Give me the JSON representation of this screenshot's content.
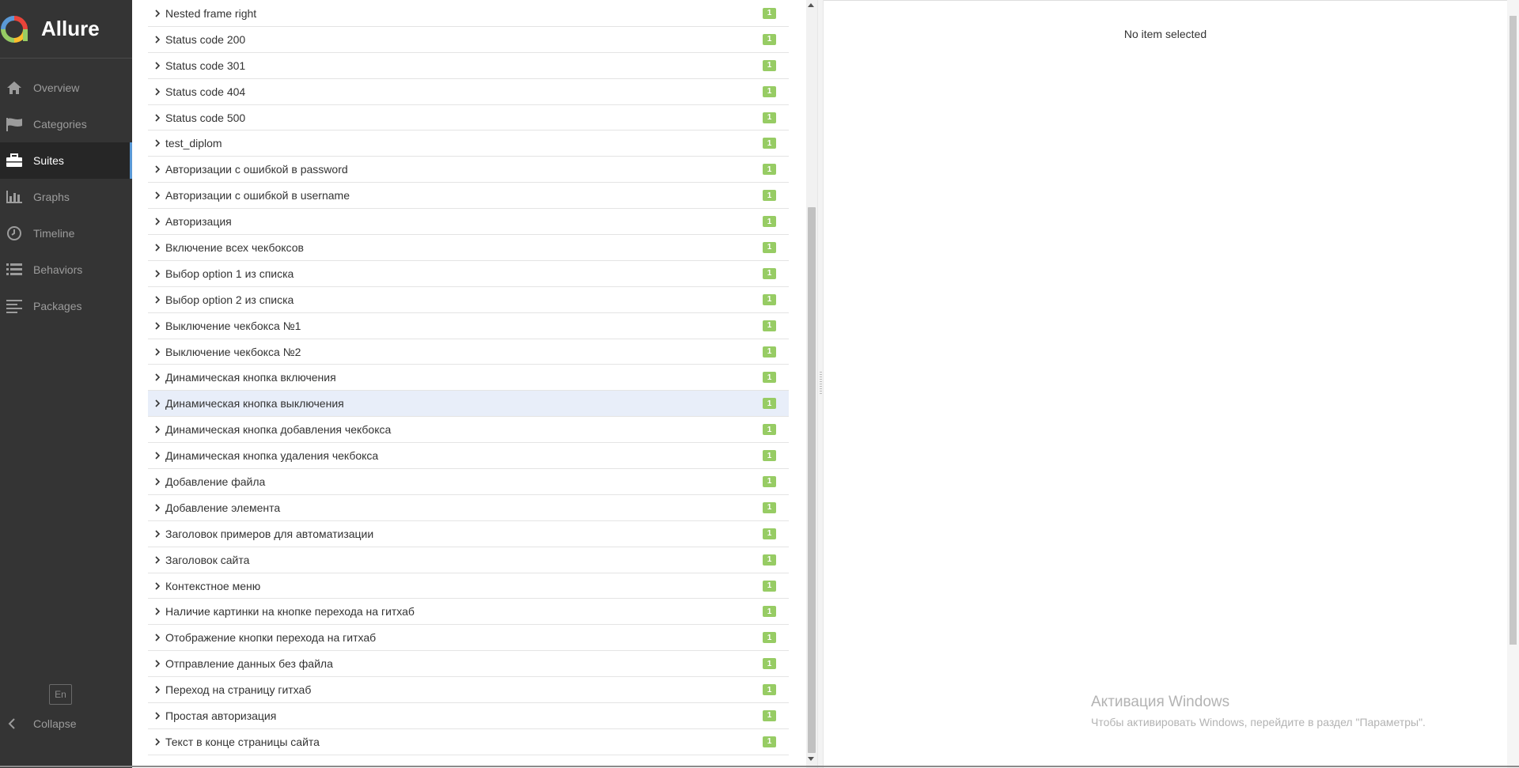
{
  "brand": {
    "name": "Allure"
  },
  "nav": {
    "items": [
      {
        "label": "Overview",
        "icon": "home-icon",
        "active": false
      },
      {
        "label": "Categories",
        "icon": "flag-icon",
        "active": false
      },
      {
        "label": "Suites",
        "icon": "briefcase-icon",
        "active": true
      },
      {
        "label": "Graphs",
        "icon": "bar-chart-icon",
        "active": false
      },
      {
        "label": "Timeline",
        "icon": "clock-icon",
        "active": false
      },
      {
        "label": "Behaviors",
        "icon": "list-icon",
        "active": false
      },
      {
        "label": "Packages",
        "icon": "align-left-icon",
        "active": false
      }
    ],
    "language": "En",
    "collapse_label": "Collapse"
  },
  "tree": {
    "rows": [
      {
        "label": "Nested frame right",
        "count": "1"
      },
      {
        "label": "Status code 200",
        "count": "1"
      },
      {
        "label": "Status code 301",
        "count": "1"
      },
      {
        "label": "Status code 404",
        "count": "1"
      },
      {
        "label": "Status code 500",
        "count": "1"
      },
      {
        "label": "test_diplom",
        "count": "1"
      },
      {
        "label": "Авторизации с ошибкой в password",
        "count": "1"
      },
      {
        "label": "Авторизации с ошибкой в username",
        "count": "1"
      },
      {
        "label": "Авторизация",
        "count": "1"
      },
      {
        "label": "Включение всех чекбоксов",
        "count": "1"
      },
      {
        "label": "Выбор option 1 из списка",
        "count": "1"
      },
      {
        "label": "Выбор option 2 из списка",
        "count": "1"
      },
      {
        "label": "Выключение чекбокса №1",
        "count": "1"
      },
      {
        "label": "Выключение чекбокса №2",
        "count": "1"
      },
      {
        "label": "Динамическая кнопка включения",
        "count": "1"
      },
      {
        "label": "Динамическая кнопка выключения",
        "count": "1",
        "selected": true
      },
      {
        "label": "Динамическая кнопка добавления чекбокса",
        "count": "1"
      },
      {
        "label": "Динамическая кнопка удаления чекбокса",
        "count": "1"
      },
      {
        "label": "Добавление файла",
        "count": "1"
      },
      {
        "label": "Добавление элемента",
        "count": "1"
      },
      {
        "label": "Заголовок примеров для автоматизации",
        "count": "1"
      },
      {
        "label": "Заголовок сайта",
        "count": "1"
      },
      {
        "label": "Контекстное меню",
        "count": "1"
      },
      {
        "label": "Наличие картинки на кнопке перехода на гитхаб",
        "count": "1"
      },
      {
        "label": "Отображение кнопки перехода на гитхаб",
        "count": "1"
      },
      {
        "label": "Отправление данных без файла",
        "count": "1"
      },
      {
        "label": "Переход на страницу гитхаб",
        "count": "1"
      },
      {
        "label": "Простая авторизация",
        "count": "1"
      },
      {
        "label": "Текст в конце страницы сайта",
        "count": "1"
      }
    ]
  },
  "detail": {
    "empty_text": "No item selected"
  },
  "watermark": {
    "title": "Активация Windows",
    "subtitle": "Чтобы активировать Windows, перейдите в раздел \"Параметры\"."
  },
  "colors": {
    "sidebar_bg": "#343434",
    "accent": "#5a99d6",
    "passed_badge": "#97cc64",
    "selected_row": "#e8eef9"
  }
}
